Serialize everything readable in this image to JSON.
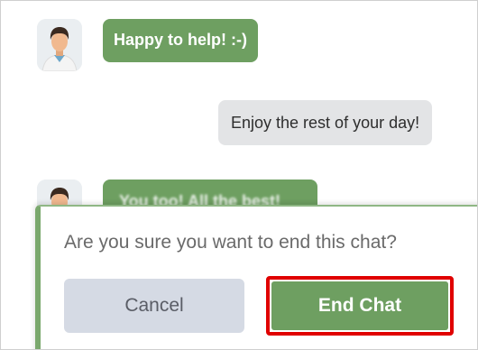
{
  "messages": [
    {
      "sender": "agent",
      "text": "Happy to help! :-)"
    },
    {
      "sender": "user",
      "text": "Enjoy the rest of your day!"
    },
    {
      "sender": "agent",
      "text": "You too! All the best!"
    }
  ],
  "confirm_dialog": {
    "question": "Are you sure you want to end this chat?",
    "cancel_label": "Cancel",
    "end_label": "End Chat"
  },
  "colors": {
    "agent_bubble": "#6e9f61",
    "user_bubble": "#e3e4e6",
    "highlight_border": "#e00000"
  },
  "icons": {
    "avatar": "agent-avatar-icon"
  }
}
